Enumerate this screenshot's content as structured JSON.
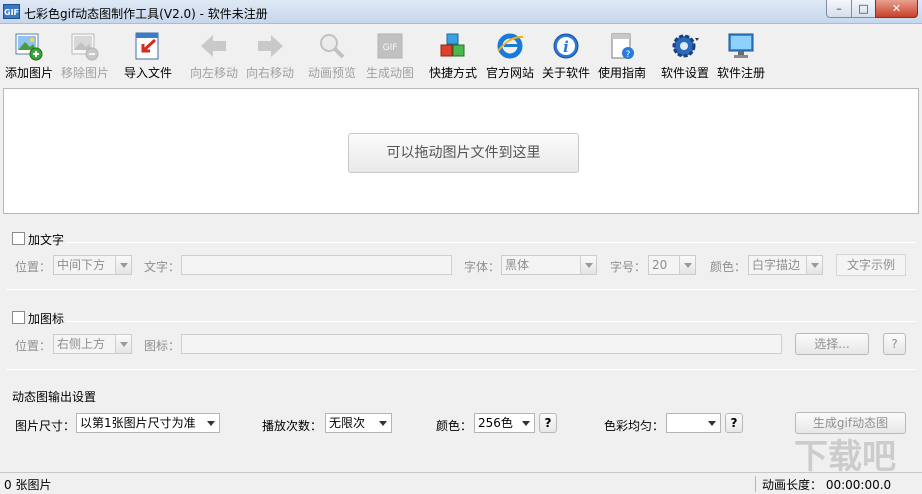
{
  "window": {
    "title": "七彩色gif动态图制作工具(V2.0) - 软件未注册",
    "app_icon_text": "GIF",
    "minimize": "–",
    "maximize": "□",
    "close": "✕"
  },
  "toolbar": {
    "items": [
      {
        "label": "添加图片",
        "icon": "add-image-icon",
        "enabled": true
      },
      {
        "label": "移除图片",
        "icon": "remove-image-icon",
        "enabled": false
      },
      {
        "label": "导入文件",
        "icon": "import-file-icon",
        "enabled": true
      },
      {
        "label": "向左移动",
        "icon": "arrow-left-icon",
        "enabled": false
      },
      {
        "label": "向右移动",
        "icon": "arrow-right-icon",
        "enabled": false
      },
      {
        "label": "动画预览",
        "icon": "magnifier-icon",
        "enabled": false
      },
      {
        "label": "生成动图",
        "icon": "gif-icon",
        "enabled": false
      },
      {
        "label": "快捷方式",
        "icon": "cubes-icon",
        "enabled": true
      },
      {
        "label": "官方网站",
        "icon": "ie-browser-icon",
        "enabled": true
      },
      {
        "label": "关于软件",
        "icon": "info-icon",
        "enabled": true
      },
      {
        "label": "使用指南",
        "icon": "help-document-icon",
        "enabled": true
      },
      {
        "label": "软件设置",
        "icon": "gear-icon",
        "enabled": true
      },
      {
        "label": "软件注册",
        "icon": "monitor-icon",
        "enabled": true
      }
    ]
  },
  "dropzone": {
    "hint": "可以拖动图片文件到这里"
  },
  "text_section": {
    "checkbox_label": "加文字",
    "checked": false,
    "position_label": "位置：",
    "position_value": "中间下方",
    "text_label": "文字：",
    "text_value": "",
    "font_label": "字体：",
    "font_value": "黑体",
    "size_label": "字号：",
    "size_value": "20",
    "color_label": "颜色：",
    "color_value": "白字描边",
    "sample_button": "文字示例"
  },
  "icon_section": {
    "checkbox_label": "加图标",
    "checked": false,
    "position_label": "位置：",
    "position_value": "右侧上方",
    "icon_label": "图标：",
    "icon_value": "",
    "choose_button": "选择...",
    "help_button": "?"
  },
  "output_section": {
    "title": "动态图输出设置",
    "size_label": "图片尺寸：",
    "size_value": "以第1张图片尺寸为准",
    "loops_label": "播放次数：",
    "loops_value": "无限次",
    "colors_label": "颜色：",
    "colors_value": "256色",
    "colors_help": "?",
    "dither_label": "色彩均匀：",
    "dither_value": "",
    "dither_help": "?",
    "generate_button": "生成gif动态图"
  },
  "statusbar": {
    "image_count": "0 张图片",
    "duration": "动画长度：  00:00:00.0"
  },
  "colors": {
    "title_gradient_top": "#dfe9f5",
    "close_red": "#c7402a",
    "disabled_text": "#a0a0a0"
  }
}
